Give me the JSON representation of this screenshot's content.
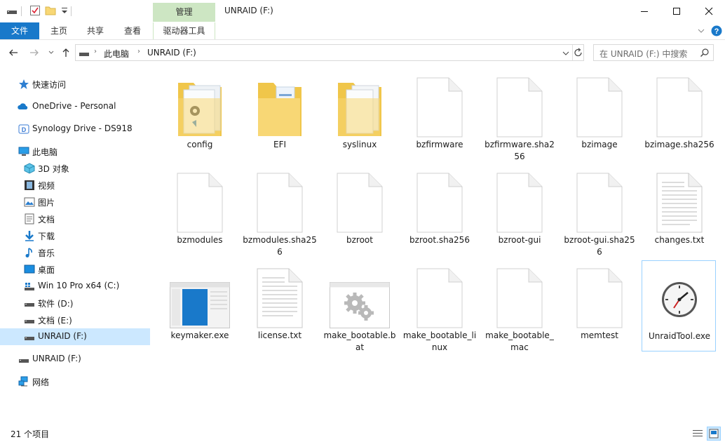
{
  "titlebar": {
    "context_tab": "管理",
    "title": "UNRAID (F:)"
  },
  "ribbon": {
    "tabs": [
      "文件",
      "主页",
      "共享",
      "查看",
      "驱动器工具"
    ]
  },
  "address": {
    "crumbs": [
      "此电脑",
      "UNRAID (F:)"
    ],
    "search_placeholder": "在 UNRAID (F:) 中搜索"
  },
  "nav": {
    "quick_access": "快速访问",
    "onedrive": "OneDrive - Personal",
    "synology": "Synology Drive - DS918",
    "this_pc": "此电脑",
    "items": [
      "3D 对象",
      "视频",
      "图片",
      "文档",
      "下载",
      "音乐",
      "桌面",
      "Win 10 Pro x64 (C:)",
      "软件 (D:)",
      "文档 (E:)",
      "UNRAID (F:)"
    ],
    "unraid": "UNRAID (F:)",
    "network": "网络"
  },
  "files": [
    {
      "name": "config",
      "icon": "folder-gear-icon"
    },
    {
      "name": "EFI",
      "icon": "folder-doc-icon"
    },
    {
      "name": "syslinux",
      "icon": "folder-pages-icon"
    },
    {
      "name": "bzfirmware",
      "icon": "blank-file-icon"
    },
    {
      "name": "bzfirmware.sha256",
      "icon": "blank-file-icon"
    },
    {
      "name": "bzimage",
      "icon": "blank-file-icon"
    },
    {
      "name": "bzimage.sha256",
      "icon": "blank-file-icon"
    },
    {
      "name": "bzmodules",
      "icon": "blank-file-icon"
    },
    {
      "name": "bzmodules.sha256",
      "icon": "blank-file-icon"
    },
    {
      "name": "bzroot",
      "icon": "blank-file-icon"
    },
    {
      "name": "bzroot.sha256",
      "icon": "blank-file-icon"
    },
    {
      "name": "bzroot-gui",
      "icon": "blank-file-icon"
    },
    {
      "name": "bzroot-gui.sha256",
      "icon": "blank-file-icon"
    },
    {
      "name": "changes.txt",
      "icon": "text-file-icon"
    },
    {
      "name": "keymaker.exe",
      "icon": "exe-window-icon"
    },
    {
      "name": "license.txt",
      "icon": "text-file-icon"
    },
    {
      "name": "make_bootable.bat",
      "icon": "batch-gears-icon"
    },
    {
      "name": "make_bootable_linux",
      "icon": "blank-file-icon"
    },
    {
      "name": "make_bootable_mac",
      "icon": "blank-file-icon"
    },
    {
      "name": "memtest",
      "icon": "blank-file-icon"
    },
    {
      "name": "UnraidTool.exe",
      "icon": "clock-app-icon"
    }
  ],
  "status": {
    "count": "21 个项目"
  },
  "colors": {
    "accent": "#1979ca",
    "manage_tab": "#cde6c3",
    "selection": "#cce8ff",
    "folder": "#f8d775"
  }
}
